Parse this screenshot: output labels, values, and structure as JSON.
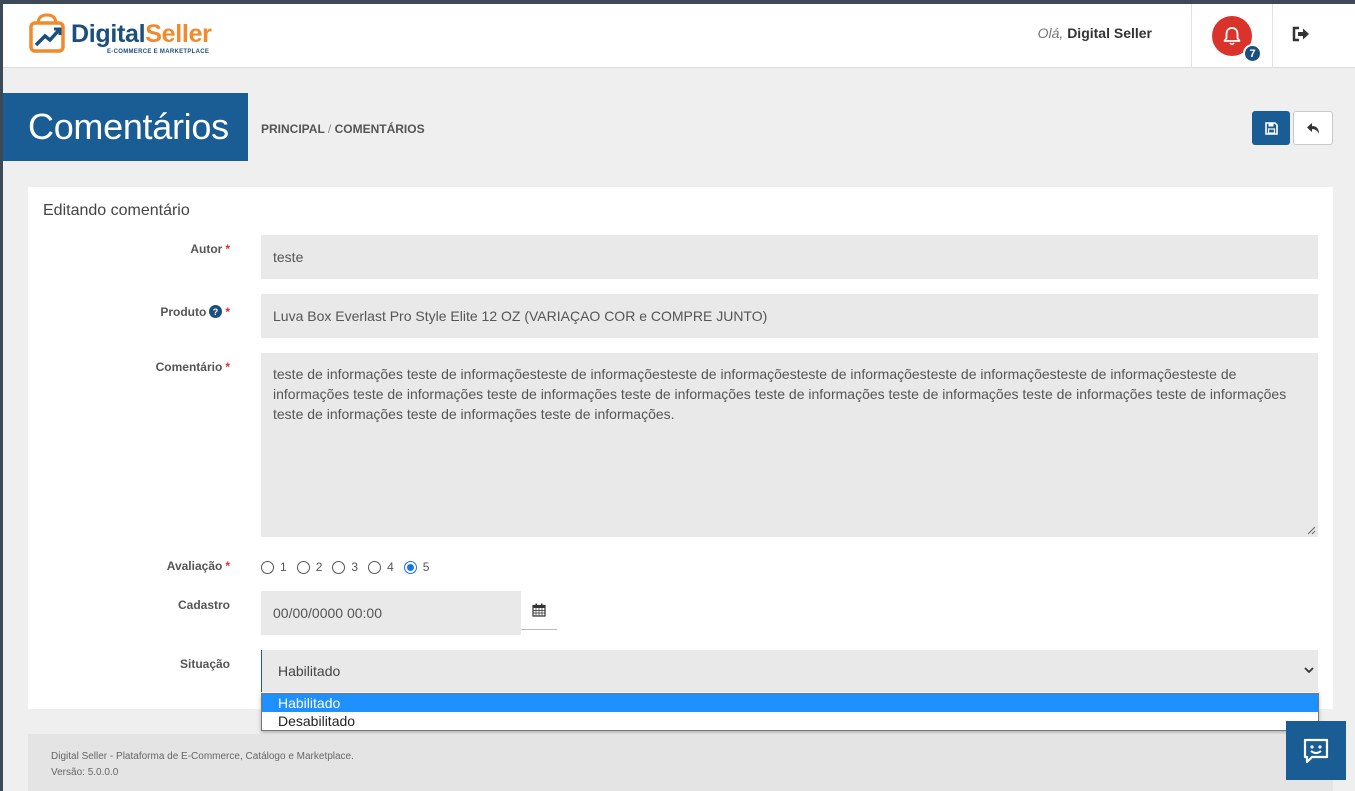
{
  "header": {
    "brand": {
      "part1": "Digital",
      "part2": "Seller",
      "tagline": "E-COMMERCE E MARKETPLACE"
    },
    "greeting_prefix": "Olá,",
    "user_name": "Digital Seller",
    "notifications_count": "7",
    "accent_color": "#1a5d94",
    "alert_color": "#d9332b",
    "icons": [
      "bell-icon",
      "logout-icon"
    ]
  },
  "page": {
    "title": "Comentários",
    "breadcrumb": {
      "home": "PRINCIPAL",
      "separator": "/",
      "current": "COMENTÁRIOS"
    },
    "actions": {
      "save_icon": "floppy-icon",
      "back_icon": "reply-icon"
    }
  },
  "form": {
    "title": "Editando comentário",
    "required_mark": "*",
    "autor": {
      "label": "Autor",
      "value": "teste"
    },
    "produto": {
      "label": "Produto",
      "value": "Luva Box Everlast Pro Style Elite 12 OZ (VARIAÇAO COR e COMPRE JUNTO)"
    },
    "comentario": {
      "label": "Comentário",
      "value": "teste de informações teste de informaçõesteste de informaçõesteste de informaçõesteste de informaçõesteste de informaçõesteste de informaçõesteste de informações teste de informações teste de informações teste de informações teste de informações teste de informações teste de informações teste de informações teste de informações teste de informações teste de informações."
    },
    "avaliacao": {
      "label": "Avaliação",
      "options": [
        "1",
        "2",
        "3",
        "4",
        "5"
      ],
      "selected": "5"
    },
    "cadastro": {
      "label": "Cadastro",
      "value": "00/00/0000 00:00"
    },
    "situacao": {
      "label": "Situação",
      "value": "Habilitado",
      "options": [
        "Habilitado",
        "Desabilitado"
      ]
    }
  },
  "footer": {
    "line1": "Digital Seller - Plataforma de E-Commerce, Catálogo e Marketplace.",
    "line2": "Versão: 5.0.0.0"
  }
}
